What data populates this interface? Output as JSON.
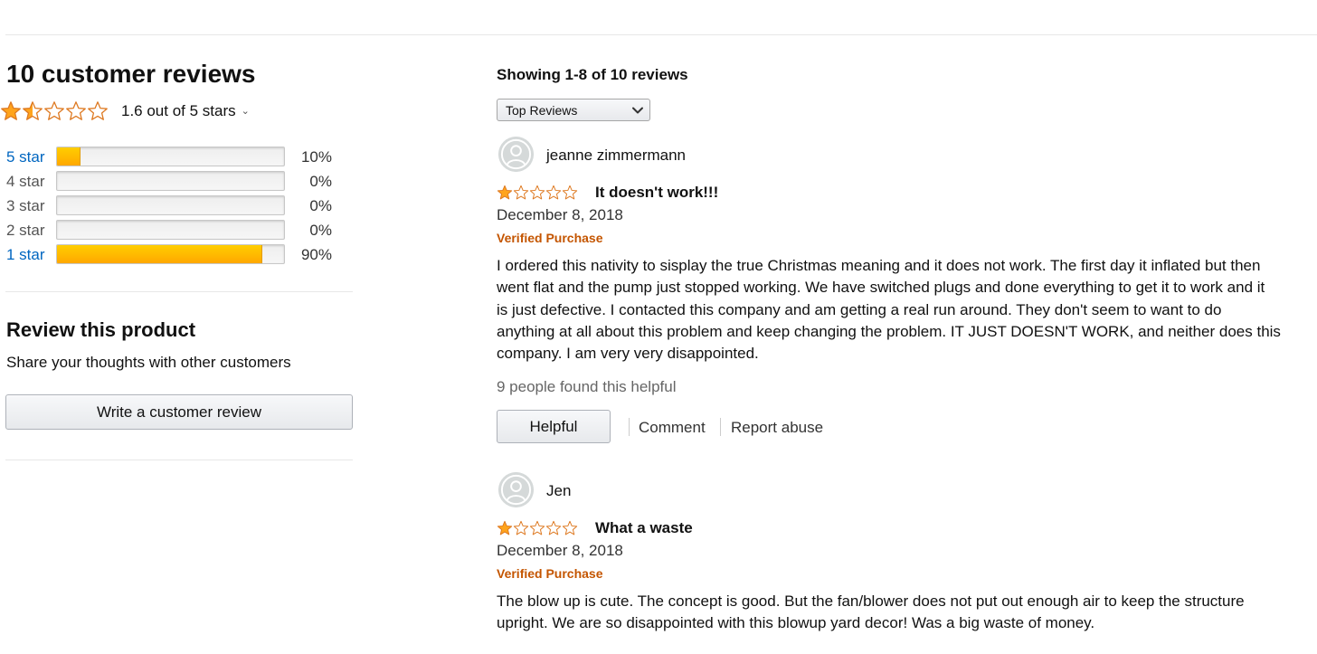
{
  "summary": {
    "title": "10 customer reviews",
    "average_rating": 1.6,
    "rating_text": "1.6 out of 5 stars",
    "histogram": [
      {
        "label": "5 star",
        "percent_text": "10%",
        "fraction": 0.1,
        "linked": true
      },
      {
        "label": "4 star",
        "percent_text": "0%",
        "fraction": 0.0,
        "linked": false
      },
      {
        "label": "3 star",
        "percent_text": "0%",
        "fraction": 0.0,
        "linked": false
      },
      {
        "label": "2 star",
        "percent_text": "0%",
        "fraction": 0.0,
        "linked": false
      },
      {
        "label": "1 star",
        "percent_text": "90%",
        "fraction": 0.9,
        "linked": true
      }
    ]
  },
  "review_product": {
    "title": "Review this product",
    "subtitle": "Share your thoughts with other customers",
    "button_label": "Write a customer review"
  },
  "list": {
    "showing_text": "Showing 1-8 of 10 reviews",
    "sort_value": "Top Reviews"
  },
  "reviews": [
    {
      "author": "jeanne zimmermann",
      "rating": 1,
      "title": "It doesn't work!!!",
      "date": "December 8, 2018",
      "verified": "Verified Purchase",
      "body_lines": [
        "I ordered this nativity to sisplay the true Christmas meaning and it does not work. The first day it inflated but then",
        "went flat and the pump just stopped working. We have switched plugs and done everything to get it to work and it",
        "is just defective. I contacted this company and am getting a real run around. They don't seem to want to do",
        "anything at all about this problem and keep changing the problem. IT JUST DOESN'T WORK, and neither does this",
        "company. I am very very disappointed."
      ],
      "helpful_count": "9 people found this helpful",
      "helpful_label": "Helpful",
      "comment_label": "Comment",
      "report_label": "Report abuse"
    },
    {
      "author": "Jen",
      "rating": 1,
      "title": "What a waste",
      "date": "December 8, 2018",
      "verified": "Verified Purchase",
      "body_lines": [
        "The blow up is cute. The concept is good. But the fan/blower does not put out enough air to keep the structure",
        "upright. We are so disappointed with this blowup yard decor! Was a big waste of money."
      ]
    }
  ],
  "colors": {
    "star_fill": "#ffa41c",
    "star_outline": "#de7921",
    "link": "#0066c0",
    "verified": "#c45500",
    "bar_fill": "#ffb800"
  },
  "icons": {
    "star": "star-icon",
    "half_star": "half-star-icon",
    "empty_star": "empty-star-icon",
    "avatar": "default-avatar-icon",
    "chevron": "chevron-down-icon"
  }
}
